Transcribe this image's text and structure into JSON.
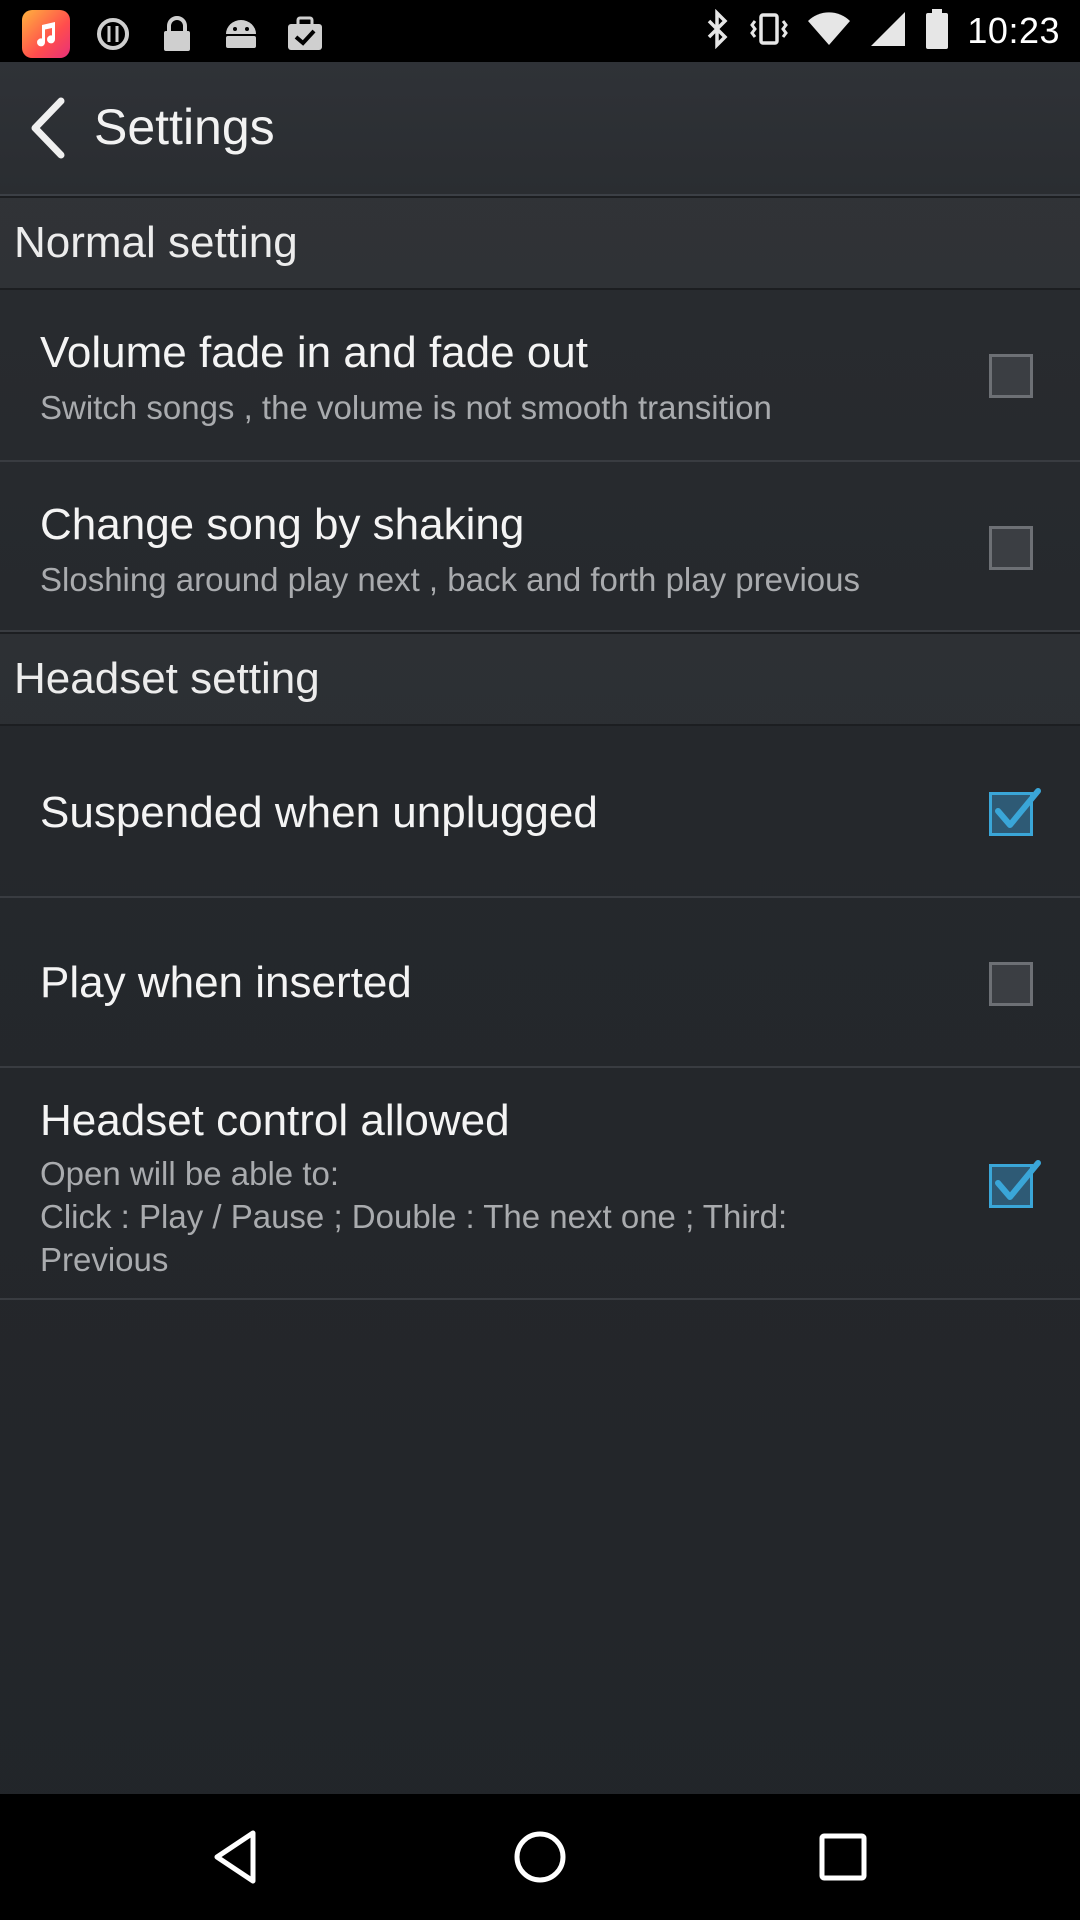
{
  "status_bar": {
    "time": "10:23",
    "left_icons": [
      "music-app-icon",
      "alert-circle-icon",
      "lock-icon",
      "android-icon",
      "clipboard-check-icon"
    ],
    "right_icons": [
      "bluetooth-icon",
      "vibrate-icon",
      "wifi-icon",
      "signal-icon",
      "battery-icon"
    ]
  },
  "header": {
    "title": "Settings"
  },
  "sections": [
    {
      "title": "Normal setting",
      "items": [
        {
          "title": "Volume fade in and fade out",
          "subtitle": "Switch songs , the volume is not smooth transition",
          "checked": false
        },
        {
          "title": "Change song by shaking",
          "subtitle": "Sloshing around play next , back and forth play previous",
          "checked": false
        }
      ]
    },
    {
      "title": "Headset setting",
      "items": [
        {
          "title": "Suspended when unplugged",
          "subtitle": "",
          "checked": true
        },
        {
          "title": "Play when inserted",
          "subtitle": "",
          "checked": false
        },
        {
          "title": "Headset control allowed",
          "subtitle": "Open will be able to:\nClick : Play / Pause ; Double : The next one ; Third:\nPrevious",
          "checked": true
        }
      ]
    }
  ],
  "nav_bar": {
    "icons": [
      "back-nav-icon",
      "home-nav-icon",
      "recents-nav-icon"
    ]
  },
  "colors": {
    "accent": "#3aa6d8",
    "background": "#25282c"
  }
}
